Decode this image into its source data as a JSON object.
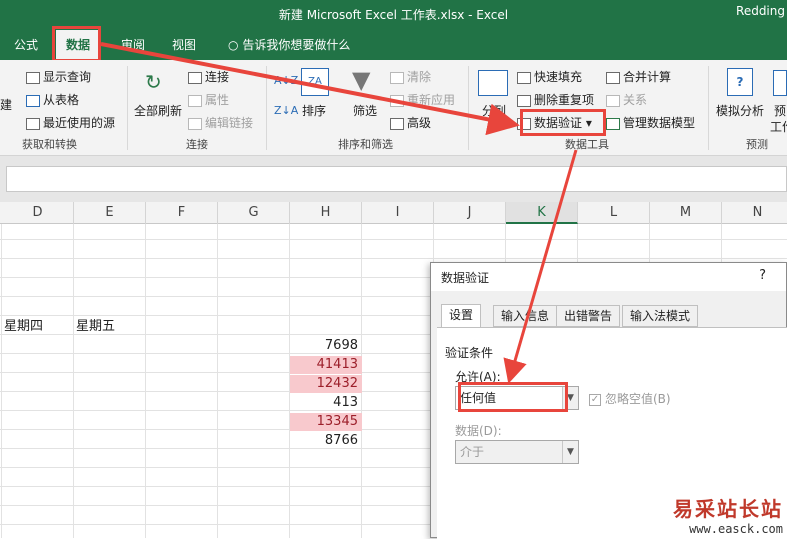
{
  "window": {
    "title": "新建 Microsoft Excel 工作表.xlsx - Excel",
    "user": "Redding"
  },
  "tabs": {
    "formulas": "公式",
    "data": "数据",
    "review": "审阅",
    "view": "视图",
    "tellme": "告诉我你想要做什么"
  },
  "ribbon": {
    "get_transform": {
      "new_query_partial": "建",
      "show_query": "显示查询",
      "from_table": "从表格",
      "recent_sources": "最近使用的源",
      "label": "获取和转换"
    },
    "connections": {
      "refresh_all": "全部刷新",
      "connections": "连接",
      "properties": "属性",
      "edit_links": "编辑链接",
      "label": "连接"
    },
    "sort_filter": {
      "sort": "排序",
      "filter": "筛选",
      "clear": "清除",
      "reapply": "重新应用",
      "advanced": "高级",
      "label": "排序和筛选"
    },
    "data_tools": {
      "split": "分列",
      "flash_fill": "快速填充",
      "remove_duplicates": "删除重复项",
      "data_validation": "数据验证",
      "consolidate": "合并计算",
      "relationships": "关系",
      "manage_model": "管理数据模型",
      "label": "数据工具"
    },
    "forecast": {
      "what_if": "模拟分析",
      "forecast_sheet_a": "预",
      "forecast_sheet_b": "工作",
      "label": "预测"
    }
  },
  "grid": {
    "columns": [
      "D",
      "E",
      "F",
      "G",
      "H",
      "I",
      "J",
      "K",
      "L",
      "M",
      "N"
    ],
    "selected_column": "K",
    "headers": {
      "thursday": "星期四",
      "friday": "星期五"
    },
    "h_values": [
      "7698",
      "41413",
      "12432",
      "413",
      "13345",
      "8766"
    ],
    "highlighted": [
      false,
      true,
      true,
      false,
      true,
      false
    ]
  },
  "dialog": {
    "title": "数据验证",
    "help": "?",
    "tabs": {
      "settings": "设置",
      "input_message": "输入信息",
      "error_alert": "出错警告",
      "ime_mode": "输入法模式"
    },
    "criteria_label": "验证条件",
    "allow_label": "允许(A):",
    "allow_value": "任何值",
    "ignore_blank": "忽略空值(B)",
    "data_label": "数据(D):",
    "data_value": "介于"
  },
  "watermark": {
    "text": "易采站长站",
    "url": "www.easck.com"
  },
  "colors": {
    "excel_green": "#217346",
    "highlight_red": "#e8453c",
    "cell_pink": "#f8c9cd"
  }
}
